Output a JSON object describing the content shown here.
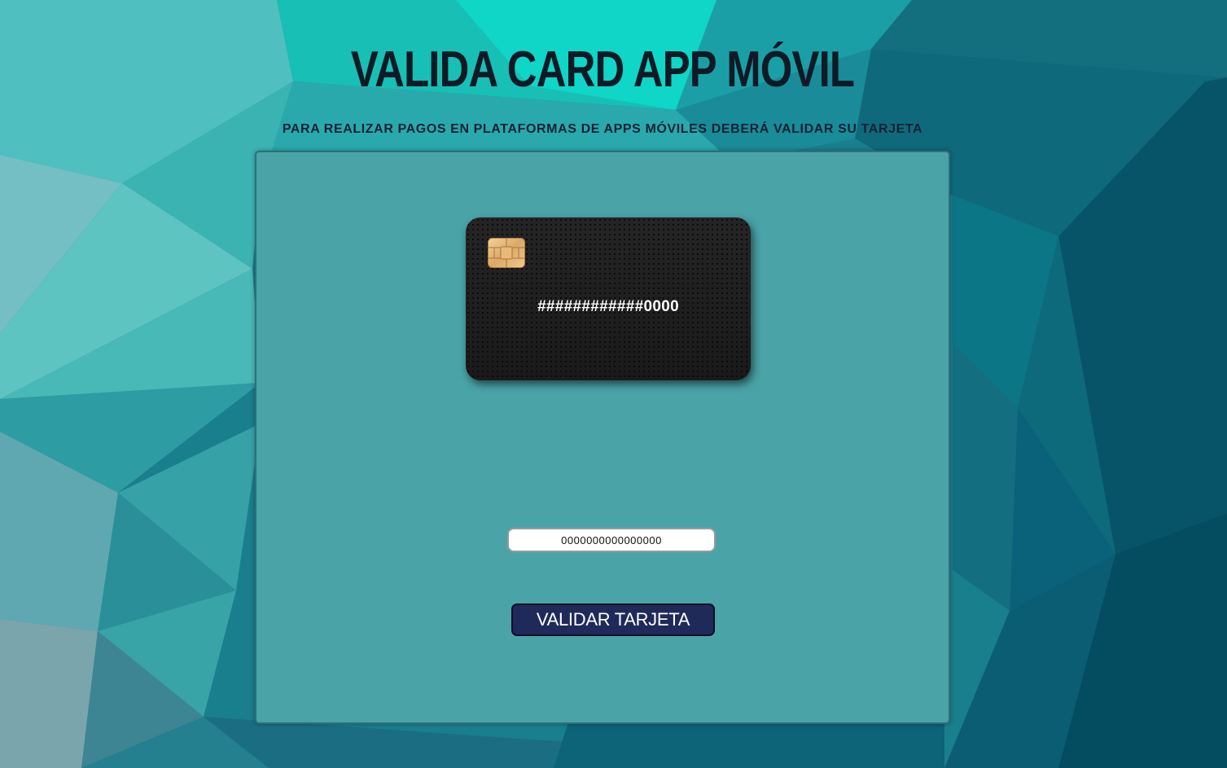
{
  "header": {
    "title": "VALIDA CARD APP MÓVIL",
    "subtitle": "PARA REALIZAR PAGOS EN PLATAFORMAS DE APPS MÓVILES DEBERÁ VALIDAR SU TARJETA"
  },
  "card": {
    "masked_number": "############0000",
    "chip_icon": "chip-icon"
  },
  "form": {
    "card_number_value": "0000000000000000",
    "submit_label": "VALIDAR TARJETA"
  },
  "colors": {
    "panel": "#4aa3a7",
    "button": "#1f2a5a",
    "title": "#0e1a26"
  }
}
